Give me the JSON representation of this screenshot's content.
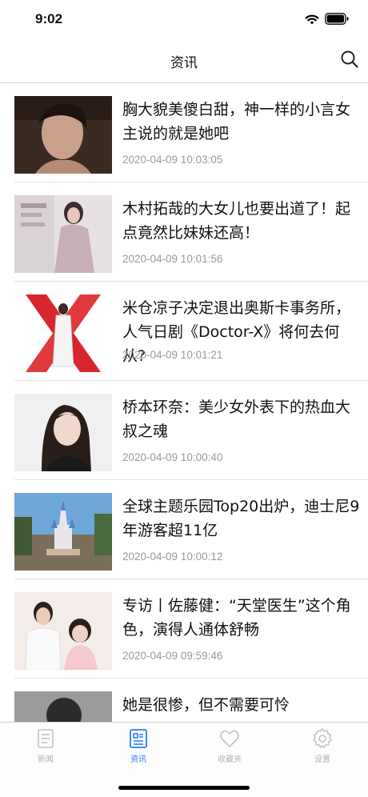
{
  "status": {
    "time": "9:02"
  },
  "nav": {
    "title": "资讯",
    "search_icon": "search-icon"
  },
  "news": [
    {
      "title": "胸大貌美傻白甜，神一样的小言女主说的就是她吧",
      "time": "2020-04-09 10:03:05"
    },
    {
      "title": "木村拓哉的大女儿也要出道了！起点竟然比妹妹还高！",
      "time": "2020-04-09 10:01:56"
    },
    {
      "title": "米仓凉子决定退出奥斯卡事务所，人气日剧《Doctor-X》将何去何从?",
      "time": "2020-04-09 10:01:21"
    },
    {
      "title": "桥本环奈：美少女外表下的热血大叔之魂",
      "time": "2020-04-09 10:00:40"
    },
    {
      "title": "全球主题乐园Top20出炉，迪士尼9年游客超11亿",
      "time": "2020-04-09 10:00:12"
    },
    {
      "title": "专访丨佐藤健：“天堂医生”这个角色，演得人通体舒畅",
      "time": "2020-04-09 09:59:46"
    },
    {
      "title": "她是很惨，但不需要可怜",
      "time": ""
    }
  ],
  "tabs": [
    {
      "label": "新闻",
      "icon": "news-icon",
      "active": false
    },
    {
      "label": "资讯",
      "icon": "info-icon",
      "active": true
    },
    {
      "label": "收藏夹",
      "icon": "heart-icon",
      "active": false
    },
    {
      "label": "设置",
      "icon": "gear-icon",
      "active": false
    }
  ],
  "colors": {
    "accent": "#2e7cf6",
    "inactive": "#b3b3b3",
    "timestamp": "#9a9a9a"
  }
}
